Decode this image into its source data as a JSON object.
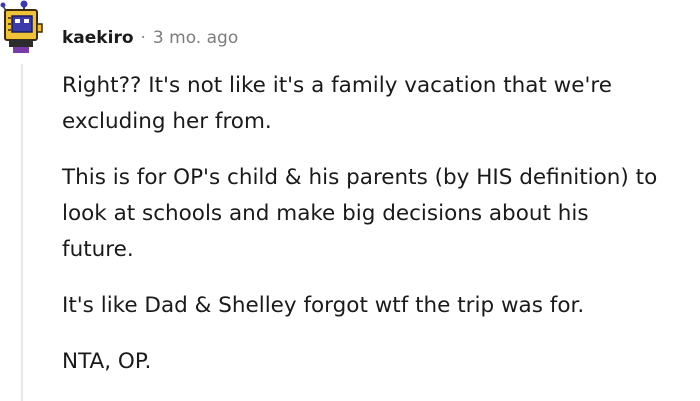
{
  "comment": {
    "author": "kaekiro",
    "separator": "·",
    "timestamp": "3 mo. ago",
    "avatar_icon": "snoo-avatar-icon",
    "paragraphs": [
      {
        "lines": [
          "Right?? It's not like it's a family vacation that we're",
          "excluding her from."
        ]
      },
      {
        "lines": [
          "This is for OP's child & his parents (by HIS definition) to",
          "look at schools and make big decisions about his",
          "future."
        ]
      },
      {
        "lines": [
          "It's like Dad & Shelley forgot wtf the trip was for."
        ]
      },
      {
        "lines": [
          "NTA, OP."
        ]
      }
    ]
  },
  "colors": {
    "text": "#1a1a1b",
    "meta": "#7c7c7c",
    "thread_line": "#e6e6e6",
    "avatar_body": "#f0c23a",
    "avatar_screen": "#3b3aa8"
  }
}
